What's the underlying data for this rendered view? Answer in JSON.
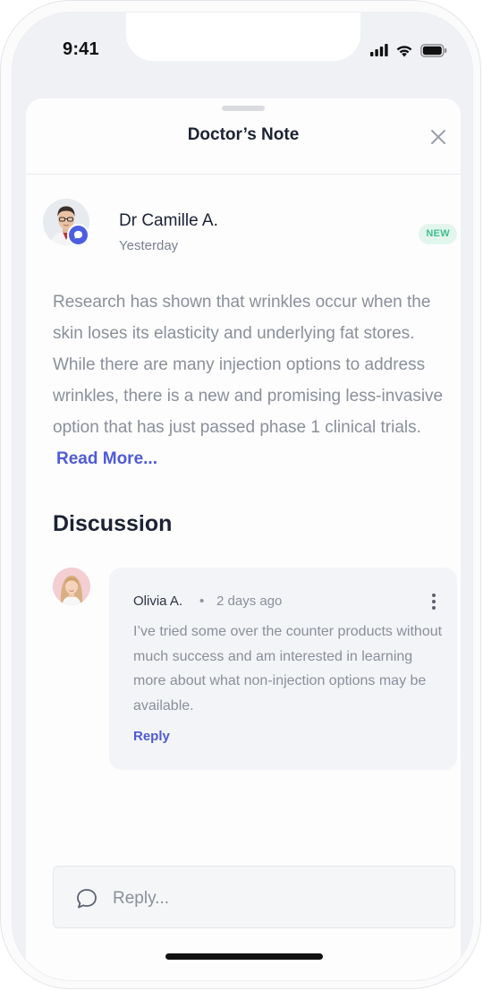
{
  "status_bar": {
    "time": "9:41",
    "icons": [
      "cellular-signal-icon",
      "wifi-icon",
      "battery-icon"
    ]
  },
  "sheet": {
    "title": "Doctor’s Note",
    "close_icon": "close-icon"
  },
  "note": {
    "author": "Dr Camille A.",
    "posted": "Yesterday",
    "badge": "NEW",
    "body": "Research has shown that wrinkles occur when the skin loses its elasticity and underlying fat stores. While there are many injection options to address wrinkles, there is a new and promising less-invasive option that has just passed phase 1 clinical trials.",
    "read_more": "Read More..."
  },
  "discussion": {
    "title": "Discussion",
    "comments": [
      {
        "author": "Olivia A.",
        "separator": "•",
        "time": "2 days ago",
        "body": "I’ve tried some over the counter products without much success and am interested in learning more about what non-injection options may be available.",
        "reply_label": "Reply"
      }
    ]
  },
  "reply_box": {
    "placeholder": "Reply...",
    "icon": "chat-bubble-icon"
  },
  "colors": {
    "accent": "#4f5bd5",
    "badge_text": "#3fbf8f",
    "badge_bg": "#e3f6ee",
    "chat_badge": "#4d5fe0",
    "body_text": "#8a8f9a",
    "heading": "#1c2233"
  }
}
